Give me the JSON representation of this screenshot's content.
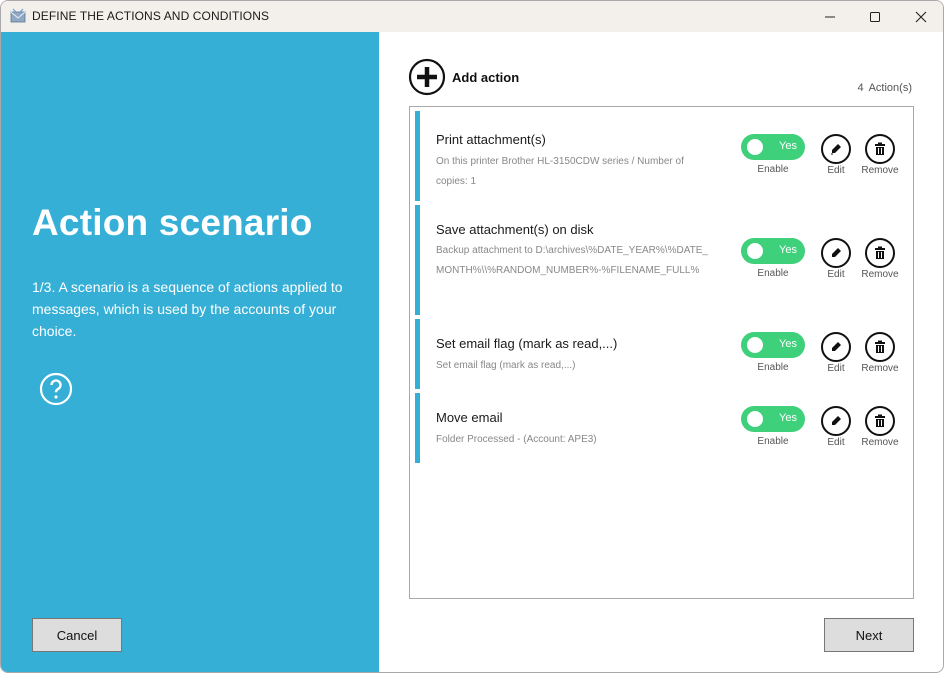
{
  "window": {
    "title": "DEFINE THE ACTIONS AND CONDITIONS",
    "controls": {
      "minimize": "—",
      "maximize": "☐",
      "close": "✕"
    }
  },
  "left": {
    "heading": "Action scenario",
    "description": "1/3. A scenario is a sequence of actions applied to messages, which is used by the accounts of your choice.",
    "help_icon": "question-circle-icon",
    "cancel_label": "Cancel"
  },
  "main": {
    "add_action_label": "Add action",
    "count_value": "4",
    "count_label": "Action(s)",
    "next_label": "Next",
    "enable_label": "Enable",
    "edit_label": "Edit",
    "remove_label": "Remove",
    "toggle_on_text": "Yes",
    "accent_color": "#36afd6",
    "toggle_color": "#3ed07a",
    "actions": [
      {
        "name": "Print attachment(s)",
        "detail": "On this printer Brother HL-3150CDW series / Number of copies: 1",
        "enabled": true
      },
      {
        "name": "Save attachment(s) on disk",
        "detail": "Backup attachment to D:\\archives\\%DATE_YEAR%\\%DATE_MONTH%\\\\%RANDOM_NUMBER%-%FILENAME_FULL%",
        "enabled": true
      },
      {
        "name": "Set email flag (mark as read,...)",
        "detail": "Set email flag (mark as read,...)",
        "enabled": true
      },
      {
        "name": "Move email",
        "detail": "Folder Processed - (Account: APE3)",
        "enabled": true
      }
    ]
  }
}
